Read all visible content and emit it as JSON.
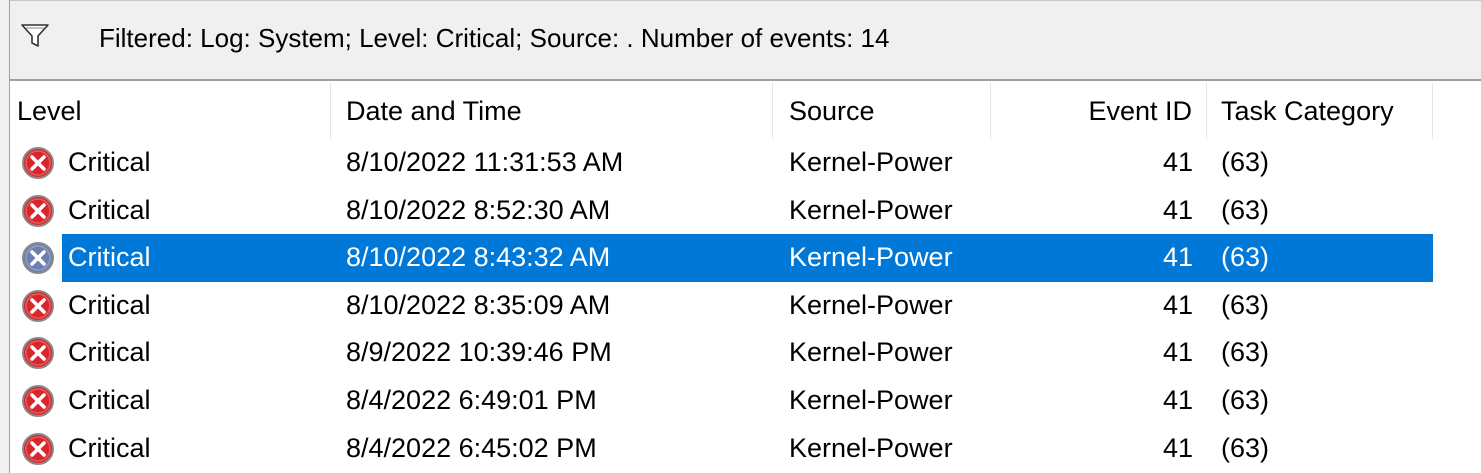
{
  "filter_bar": {
    "icon": "funnel-icon",
    "text": "Filtered: Log: System; Level: Critical; Source: . Number of events: 14"
  },
  "columns": {
    "level": "Level",
    "datetime": "Date and Time",
    "source": "Source",
    "event_id": "Event ID",
    "task_category": "Task Category"
  },
  "rows": [
    {
      "level": "Critical",
      "datetime": "8/10/2022 11:31:53 AM",
      "source": "Kernel-Power",
      "event_id": "41",
      "task_category": "(63)",
      "selected": false
    },
    {
      "level": "Critical",
      "datetime": "8/10/2022 8:52:30 AM",
      "source": "Kernel-Power",
      "event_id": "41",
      "task_category": "(63)",
      "selected": false
    },
    {
      "level": "Critical",
      "datetime": "8/10/2022 8:43:32 AM",
      "source": "Kernel-Power",
      "event_id": "41",
      "task_category": "(63)",
      "selected": true
    },
    {
      "level": "Critical",
      "datetime": "8/10/2022 8:35:09 AM",
      "source": "Kernel-Power",
      "event_id": "41",
      "task_category": "(63)",
      "selected": false
    },
    {
      "level": "Critical",
      "datetime": "8/9/2022 10:39:46 PM",
      "source": "Kernel-Power",
      "event_id": "41",
      "task_category": "(63)",
      "selected": false
    },
    {
      "level": "Critical",
      "datetime": "8/4/2022 6:49:01 PM",
      "source": "Kernel-Power",
      "event_id": "41",
      "task_category": "(63)",
      "selected": false
    },
    {
      "level": "Critical",
      "datetime": "8/4/2022 6:45:02 PM",
      "source": "Kernel-Power",
      "event_id": "41",
      "task_category": "(63)",
      "selected": false
    }
  ],
  "colors": {
    "selection": "#0078d7",
    "critical_icon": "#d9262b"
  }
}
